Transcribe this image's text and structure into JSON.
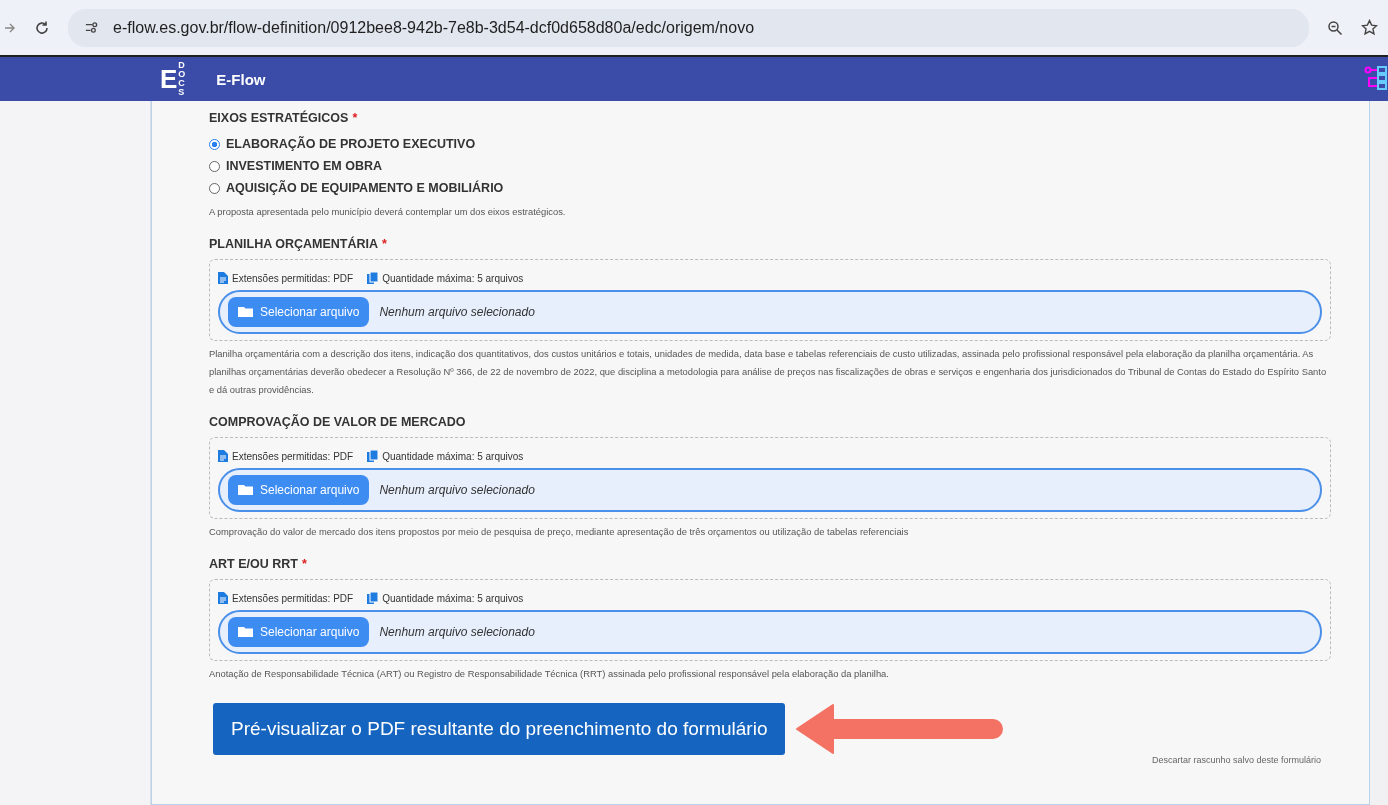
{
  "browser": {
    "url": "e-flow.es.gov.br/flow-definition/0912bee8-942b-7e8b-3d54-dcf0d658d80a/edc/origem/novo"
  },
  "header": {
    "logo_letter": "E",
    "logo_sub": "DOCS",
    "title": "E-Flow"
  },
  "fields": [
    {
      "kind": "radio",
      "label": "EIXOS ESTRATÉGICOS",
      "required_mark": "*",
      "options": [
        {
          "label": "ELABORAÇÃO DE PROJETO EXECUTIVO",
          "selected": true
        },
        {
          "label": "INVESTIMENTO EM OBRA",
          "selected": false
        },
        {
          "label": "AQUISIÇÃO DE EQUIPAMENTO E MOBILIÁRIO",
          "selected": false
        }
      ],
      "help": "A proposta apresentada pelo município deverá contemplar um dos eixos estratégicos."
    },
    {
      "kind": "file",
      "label": "PLANILHA ORÇAMENTÁRIA",
      "required_mark": "*",
      "extensions": "Extensões permitidas: PDF",
      "max_files": "Quantidade máxima: 5 arquivos",
      "button": "Selecionar arquivo",
      "status": "Nenhum arquivo selecionado",
      "help": "Planilha orçamentária com a descrição dos itens, indicação dos quantitativos, dos custos unitários e totais, unidades de medida, data base e tabelas referenciais de custo utilizadas, assinada pelo profissional responsável pela elaboração da planilha orçamentária. As planilhas orçamentárias deverão obedecer a Resolução Nº 366, de 22 de novembro de 2022, que disciplina a metodologia para análise de preços nas fiscalizações de obras e serviços e engenharia dos jurisdicionados do Tribunal de Contas do Estado do Espírito Santo e dá outras providências."
    },
    {
      "kind": "file",
      "label": "COMPROVAÇÃO DE VALOR DE MERCADO",
      "extensions": "Extensões permitidas: PDF",
      "max_files": "Quantidade máxima: 5 arquivos",
      "button": "Selecionar arquivo",
      "status": "Nenhum arquivo selecionado",
      "help": "Comprovação do valor de mercado dos itens propostos por meio de pesquisa de preço, mediante apresentação de três orçamentos ou utilização de tabelas referenciais"
    },
    {
      "kind": "file",
      "label": "ART E/OU RRT",
      "required_mark": "*",
      "extensions": "Extensões permitidas: PDF",
      "max_files": "Quantidade máxima: 5 arquivos",
      "button": "Selecionar arquivo",
      "status": "Nenhum arquivo selecionado",
      "help": "Anotação de Responsabilidade Técnica (ART) ou Registro de Responsabilidade Técnica (RRT) assinada pelo profissional responsável pela elaboração da planilha."
    }
  ],
  "preview_button": "Pré-visualizar o PDF resultante do preenchimento do formulário",
  "discard_link": "Descartar rascunho salvo deste formulário"
}
